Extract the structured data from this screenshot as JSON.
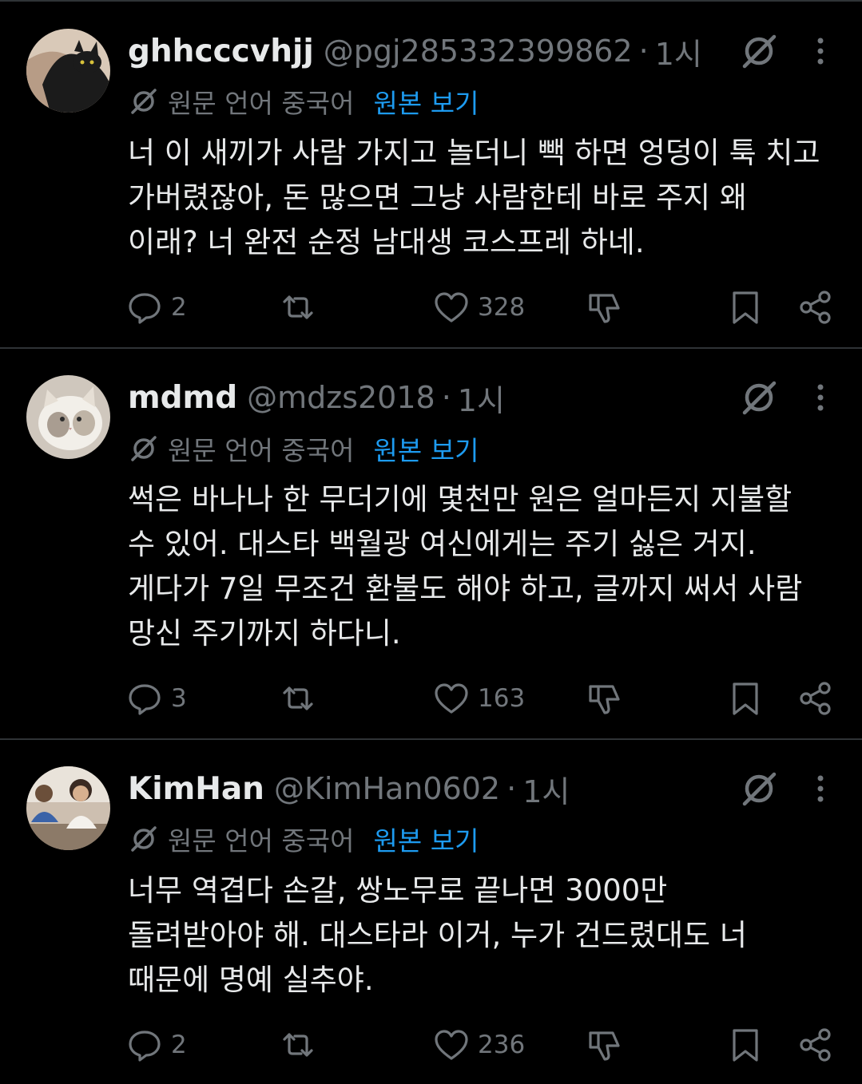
{
  "tweets": [
    {
      "name": "ghhcccvhjj",
      "handle": "@pgj285332399862",
      "dot": "·",
      "time": "1시",
      "translation": {
        "source": "원문 언어 중국어",
        "show_original": "원본 보기"
      },
      "text": "너 이 새끼가 사람 가지고 놀더니 빽 하면 엉덩이 툭 치고\n가버렸잖아, 돈 많으면 그냥 사람한테 바로 주지 왜\n이래? 너 완전 순정 남대생 코스프레 하네.",
      "replies": "2",
      "likes": "328"
    },
    {
      "name": "mdmd",
      "handle": "@mdzs2018",
      "dot": "·",
      "time": "1시",
      "translation": {
        "source": "원문 언어 중국어",
        "show_original": "원본 보기"
      },
      "text": "썩은 바나나 한 무더기에 몇천만 원은 얼마든지 지불할\n수 있어. 대스타 백월광 여신에게는 주기 싫은 거지.\n게다가 7일 무조건 환불도 해야 하고, 글까지 써서 사람\n망신 주기까지 하다니.",
      "replies": "3",
      "likes": "163"
    },
    {
      "name": "KimHan",
      "handle": "@KimHan0602",
      "dot": "·",
      "time": "1시",
      "translation": {
        "source": "원문 언어 중국어",
        "show_original": "원본 보기"
      },
      "text": "너무 역겹다 손갈, 쌍노무로 끝나면 3000만\n돌려받아야 해. 대스타라 이거, 누가 건드렸대도 너\n때문에 명예 실추야.",
      "replies": "2",
      "likes": "236"
    }
  ],
  "icons": {
    "grok": "slashed-circle-icon",
    "more": "more-vertical-icon",
    "translate": "slashed-circle-icon",
    "reply": "reply-icon",
    "retweet": "retweet-icon",
    "like": "heart-icon",
    "dislike": "thumbs-down-icon",
    "bookmark": "bookmark-icon",
    "share": "share-icon"
  },
  "colors": {
    "background": "#000000",
    "text": "#e7e9ea",
    "muted": "#71767b",
    "link": "#1d9bf0",
    "divider": "#2f3336"
  }
}
